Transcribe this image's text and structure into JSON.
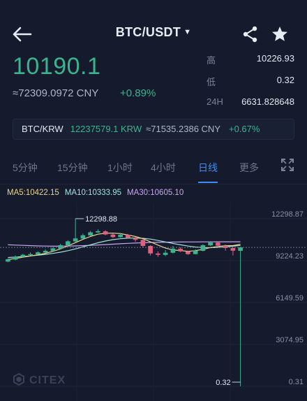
{
  "header": {
    "pair": "BTC/USDT"
  },
  "summary": {
    "last_price": "10190.1",
    "cny_price": "≈72309.0972 CNY",
    "change": "+0.89%",
    "high_label": "高",
    "high_value": "10226.93",
    "low_label": "低",
    "low_value": "0.32",
    "vol_label": "24H",
    "vol_value": "6631.828648"
  },
  "ticker": {
    "pair": "BTC/KRW",
    "krw": "12237579.1 KRW",
    "cny": "≈71535.2386 CNY",
    "change": "+0.67%"
  },
  "tabs": [
    {
      "label": "5分钟",
      "active": false
    },
    {
      "label": "15分钟",
      "active": false
    },
    {
      "label": "1小时",
      "active": false
    },
    {
      "label": "4小时",
      "active": false
    },
    {
      "label": "日线",
      "active": true
    },
    {
      "label": "更多",
      "active": false
    }
  ],
  "ma": {
    "ma5": "MA5:10422.15",
    "ma10": "MA10:10333.95",
    "ma30": "MA30:10605.10"
  },
  "watermark": "CITEX",
  "colors": {
    "up": "#3bb48e",
    "down": "#e0607e",
    "accent": "#3f8bf2",
    "background": "#151a2d"
  },
  "chart_data": {
    "type": "candlestick",
    "y_ticks": [
      "12298.87",
      "9224.23",
      "6149.59",
      "3074.95",
      "0.31"
    ],
    "ylim": [
      0.31,
      12298.87
    ],
    "annotations": {
      "high_marker": "12298.88",
      "low_marker": "0.32",
      "current_price": 10190.1
    },
    "candles": [
      {
        "o": 9150,
        "c": 9320,
        "h": 9380,
        "l": 9100
      },
      {
        "o": 9300,
        "c": 9520,
        "h": 9600,
        "l": 9250
      },
      {
        "o": 9500,
        "c": 9650,
        "h": 9720,
        "l": 9450
      },
      {
        "o": 9640,
        "c": 9700,
        "h": 9820,
        "l": 9600
      },
      {
        "o": 9690,
        "c": 9830,
        "h": 9900,
        "l": 9660
      },
      {
        "o": 9820,
        "c": 9940,
        "h": 10050,
        "l": 9780
      },
      {
        "o": 9930,
        "c": 10120,
        "h": 10200,
        "l": 9900
      },
      {
        "o": 10100,
        "c": 10350,
        "h": 10450,
        "l": 10080
      },
      {
        "o": 10340,
        "c": 10640,
        "h": 10720,
        "l": 10300
      },
      {
        "o": 10630,
        "c": 10850,
        "h": 12298.88,
        "l": 10600
      },
      {
        "o": 10840,
        "c": 11080,
        "h": 11200,
        "l": 10800
      },
      {
        "o": 11070,
        "c": 11300,
        "h": 11400,
        "l": 11030
      },
      {
        "o": 11290,
        "c": 11380,
        "h": 11520,
        "l": 11250
      },
      {
        "o": 11370,
        "c": 11140,
        "h": 11450,
        "l": 11080
      },
      {
        "o": 11130,
        "c": 10950,
        "h": 11200,
        "l": 10880
      },
      {
        "o": 10940,
        "c": 11120,
        "h": 11250,
        "l": 10900
      },
      {
        "o": 11110,
        "c": 10900,
        "h": 11180,
        "l": 10850
      },
      {
        "o": 10880,
        "c": 10750,
        "h": 10950,
        "l": 10600
      },
      {
        "o": 10740,
        "c": 10300,
        "h": 10800,
        "l": 10200
      },
      {
        "o": 10300,
        "c": 9750,
        "h": 10350,
        "l": 9600
      },
      {
        "o": 9740,
        "c": 9650,
        "h": 9900,
        "l": 9500
      },
      {
        "o": 9640,
        "c": 9800,
        "h": 10000,
        "l": 9550
      },
      {
        "o": 9800,
        "c": 10100,
        "h": 10300,
        "l": 9750
      },
      {
        "o": 10090,
        "c": 9900,
        "h": 10200,
        "l": 9850
      },
      {
        "o": 9890,
        "c": 9700,
        "h": 9950,
        "l": 9650
      },
      {
        "o": 9700,
        "c": 9950,
        "h": 10050,
        "l": 9680
      },
      {
        "o": 9940,
        "c": 10350,
        "h": 10420,
        "l": 9900
      },
      {
        "o": 10340,
        "c": 10550,
        "h": 10650,
        "l": 10300
      },
      {
        "o": 10540,
        "c": 10320,
        "h": 10600,
        "l": 10250
      },
      {
        "o": 10310,
        "c": 10150,
        "h": 10400,
        "l": 9950
      },
      {
        "o": 10140,
        "c": 9950,
        "h": 10200,
        "l": 9600
      },
      {
        "o": 9940,
        "c": 10190.1,
        "h": 10226.93,
        "l": 0.32
      }
    ],
    "ma5": [
      9300,
      9380,
      9470,
      9560,
      9650,
      9760,
      9900,
      10080,
      10300,
      10540,
      10780,
      10990,
      11160,
      11230,
      11240,
      11200,
      11100,
      10990,
      10830,
      10600,
      10360,
      10140,
      10000,
      9960,
      9900,
      9950,
      10050,
      10180,
      10260,
      10320,
      10320,
      10422.15
    ],
    "ma10": [
      9450,
      9480,
      9520,
      9570,
      9620,
      9680,
      9750,
      9840,
      9950,
      10080,
      10230,
      10380,
      10530,
      10660,
      10760,
      10830,
      10870,
      10880,
      10860,
      10800,
      10700,
      10590,
      10480,
      10380,
      10290,
      10220,
      10180,
      10170,
      10190,
      10230,
      10280,
      10333.95
    ],
    "ma30": [
      10380,
      10360,
      10340,
      10320,
      10300,
      10290,
      10280,
      10280,
      10290,
      10300,
      10320,
      10340,
      10370,
      10400,
      10430,
      10460,
      10490,
      10510,
      10530,
      10550,
      10560,
      10570,
      10580,
      10585,
      10590,
      10595,
      10598,
      10600,
      10602,
      10604,
      10605,
      10605.1
    ]
  }
}
